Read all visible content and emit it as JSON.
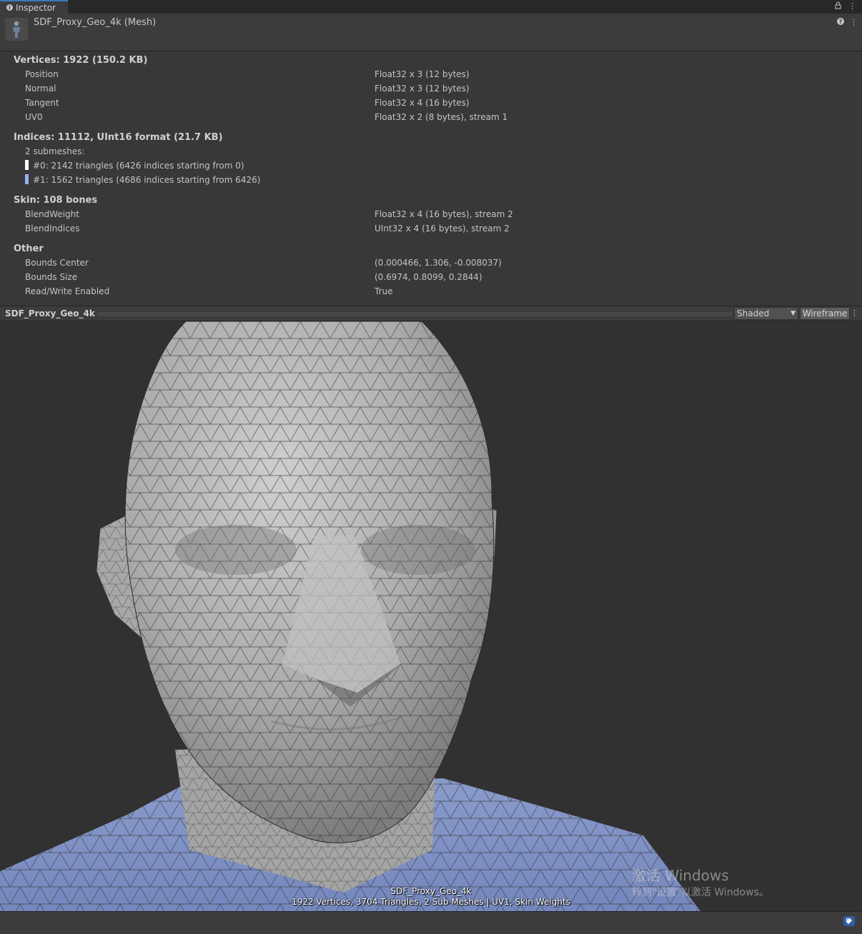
{
  "window": {
    "tab_label": "Inspector",
    "tab_icon": "info-icon",
    "lock_icon": "lock-icon",
    "menu_icon": "kebab-menu-icon"
  },
  "header": {
    "title": "SDF_Proxy_Geo_4k (Mesh)",
    "thumbnail_icon": "mesh-figure-icon",
    "help_icon": "help-icon"
  },
  "vertices": {
    "heading": "Vertices: 1922 (150.2 KB)",
    "attributes": [
      {
        "name": "Position",
        "format": "Float32 x 3 (12 bytes)"
      },
      {
        "name": "Normal",
        "format": "Float32 x 3 (12 bytes)"
      },
      {
        "name": "Tangent",
        "format": "Float32 x 4 (16 bytes)"
      },
      {
        "name": "UV0",
        "format": "Float32 x 2 (8 bytes), stream 1"
      }
    ]
  },
  "indices": {
    "heading": "Indices: 11112, UInt16 format (21.7 KB)",
    "submesh_count": "2 submeshes:",
    "submeshes": [
      {
        "label": "#0: 2142 triangles (6426 indices starting from 0)",
        "color": "#ffffff"
      },
      {
        "label": "#1: 1562 triangles (4686 indices starting from 6426)",
        "color": "#9aaef0"
      }
    ]
  },
  "skin": {
    "heading": "Skin: 108 bones",
    "attributes": [
      {
        "name": "BlendWeight",
        "format": "Float32 x 4 (16 bytes), stream 2"
      },
      {
        "name": "BlendIndices",
        "format": "UInt32 x 4 (16 bytes), stream 2"
      }
    ]
  },
  "other": {
    "heading": "Other",
    "rows": [
      {
        "name": "Bounds Center",
        "value": "(0.000466, 1.306, -0.008037)"
      },
      {
        "name": "Bounds Size",
        "value": "(0.6974, 0.8099, 0.2844)"
      },
      {
        "name": "Read/Write Enabled",
        "value": "True"
      }
    ]
  },
  "preview": {
    "title": "SDF_Proxy_Geo_4k",
    "shading_mode": "Shaded",
    "wireframe_label": "Wireframe",
    "stats_name": "SDF_Proxy_Geo_4k",
    "stats_line": "1922 Vertices, 3704 Triangles, 2 Sub Meshes | UV1, Skin Weights"
  },
  "watermark": {
    "line1": "激活 Windows",
    "line2": "转到\"设置\"以激活 Windows。"
  },
  "footer": {
    "tag_icon": "asset-label-icon"
  },
  "colors": {
    "accent": "#3a79bb",
    "head_mesh": "#b4b4b4",
    "body_mesh": "#7f92c4",
    "viewport_bg": "#313131"
  }
}
